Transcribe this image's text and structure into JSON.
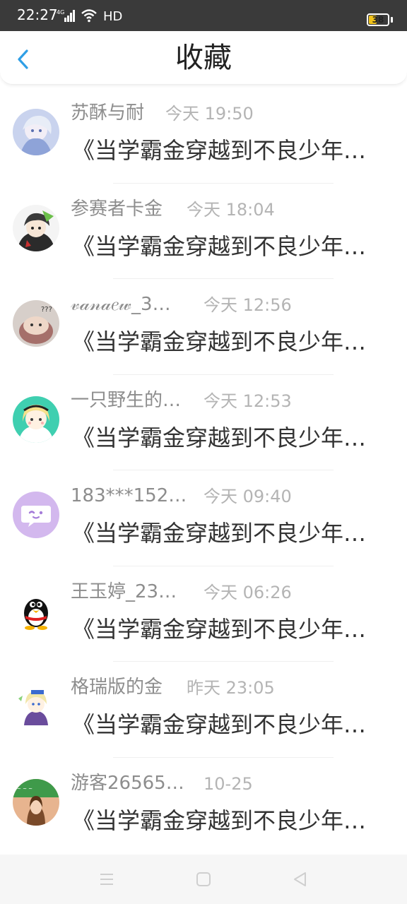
{
  "status_bar": {
    "time": "22:27",
    "signal": "4G",
    "network": "HD",
    "battery": "38"
  },
  "header": {
    "title": "收藏"
  },
  "items": [
    {
      "name": "苏酥与耐",
      "time": "今天 19:50",
      "message": "《当学霸金穿越到不良少年…"
    },
    {
      "name": "参赛者卡金",
      "time": "今天 18:04",
      "message": "《当学霸金穿越到不良少年…"
    },
    {
      "name": "𝓋𝒶𝓃𝒶𝑒𝓌_3…",
      "time": "今天 12:56",
      "message": "《当学霸金穿越到不良少年…"
    },
    {
      "name": "一只野生的…",
      "time": "今天 12:53",
      "message": "《当学霸金穿越到不良少年…"
    },
    {
      "name": "183***152…",
      "time": "今天 09:40",
      "message": "《当学霸金穿越到不良少年…"
    },
    {
      "name": "王玉婷_23…",
      "time": "今天 06:26",
      "message": "《当学霸金穿越到不良少年…"
    },
    {
      "name": "格瑞版的金",
      "time": "昨天 23:05",
      "message": "《当学霸金穿越到不良少年…"
    },
    {
      "name": "游客26565…",
      "time": "10-25",
      "message": "《当学霸金穿越到不良少年…"
    }
  ],
  "colors": {
    "accent": "#2f9fe6",
    "status_bar": "#3a3a3a",
    "name_text": "#8d8d8d",
    "time_text": "#b4b4b4",
    "message_text": "#333333"
  },
  "icons": {
    "back": "chevron-left-icon",
    "nav_menu": "menu-icon",
    "nav_home": "square-home-icon",
    "nav_back": "triangle-back-icon"
  }
}
